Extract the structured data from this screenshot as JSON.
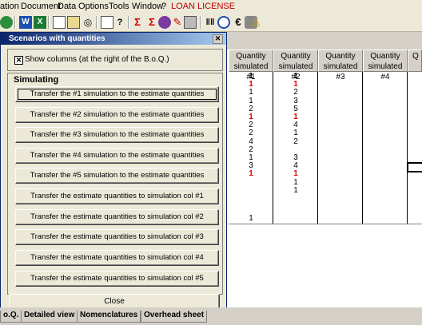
{
  "menu": [
    "ation",
    "Document",
    "Data",
    "Options",
    "Tools",
    "Window",
    "?",
    "LOAN LICENSE"
  ],
  "colors": {
    "title_start": "#0a246a",
    "loan": "#c00000",
    "red_value": "#e00000"
  },
  "dialog": {
    "title": "Scenarios with quantities",
    "show_columns_label": "Show columns (at the right of the B.o.Q.)",
    "show_columns_checked": true,
    "group_label": "Simulating",
    "buttons": [
      "Transfer the #1 simulation to the estimate quantities",
      "Transfer the #2 simulation to the estimate quantities",
      "Transfer the #3 simulation to the estimate quantities",
      "Transfer the #4 simulation to the estimate quantities",
      "Transfer the #5 simulation to the estimate quantities",
      "Transfer the estimate quantities to simulation col #1",
      "Transfer the estimate quantities to simulation col #2",
      "Transfer the estimate quantities to simulation col #3",
      "Transfer the estimate quantities to simulation col #4",
      "Transfer the estimate quantities to simulation col #5"
    ],
    "close_label": "Close"
  },
  "grid": {
    "headers": [
      {
        "line1": "Quantity",
        "line2": "simulated #1"
      },
      {
        "line1": "Quantity",
        "line2": "simulated #2"
      },
      {
        "line1": "Quantity",
        "line2": "simulated #3"
      },
      {
        "line1": "Quantity",
        "line2": "simulated #4"
      },
      {
        "line1": "Q",
        "line2": ""
      }
    ],
    "col1": [
      "1",
      "1",
      "1",
      "1",
      "2",
      "1",
      "2",
      "2",
      "4",
      "2",
      "1",
      "3",
      "1",
      "",
      ""
    ],
    "col1_style": [
      "bold",
      "red",
      "",
      "",
      "",
      "red",
      "",
      "",
      "",
      "",
      "",
      "",
      "red",
      "",
      ""
    ],
    "col2": [
      "1",
      "1",
      "2",
      "3",
      "5",
      "1",
      "4",
      "1",
      "2",
      "",
      "3",
      "4",
      "1",
      "1",
      "1"
    ],
    "col2_style": [
      "bold",
      "red",
      "",
      "",
      "",
      "red",
      "",
      "",
      "",
      "",
      "",
      "",
      "red",
      "",
      ""
    ],
    "col1_last": "1"
  },
  "tabs": [
    "o.Q.",
    "Detailed view",
    "Nomenclatures",
    "Overhead sheet"
  ]
}
